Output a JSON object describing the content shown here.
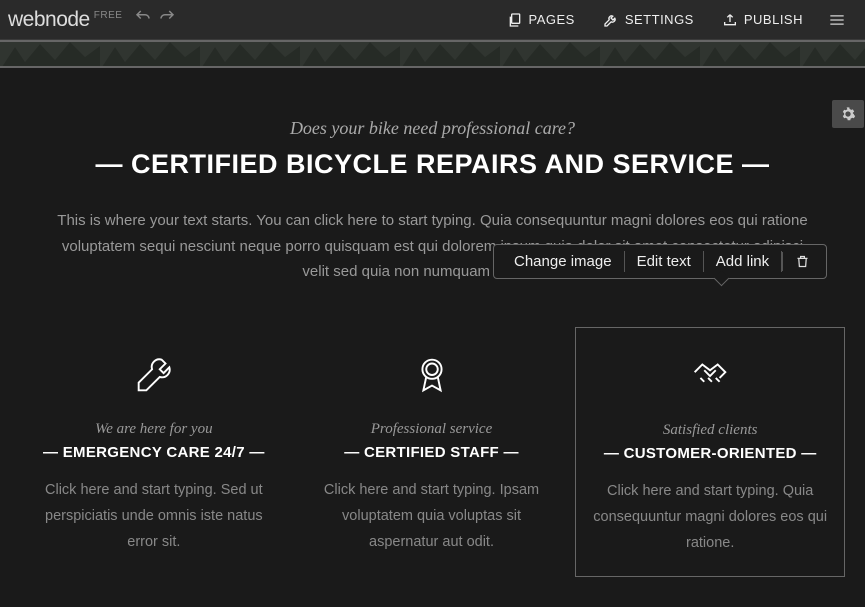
{
  "topbar": {
    "logo": "webnode",
    "plan": "FREE",
    "buttons": {
      "pages": "PAGES",
      "settings": "SETTINGS",
      "publish": "PUBLISH"
    }
  },
  "hero": {
    "subtitle": "Does your bike need professional care?",
    "heading": "— CERTIFIED BICYCLE REPAIRS AND SERVICE —",
    "body": "This is where your text starts. You can click here to start typing. Quia consequuntur magni dolores eos qui ratione voluptatem sequi nesciunt neque porro quisquam est qui dolorem ipsum quia dolor sit amet consectetur adipisci velit sed quia non numquam eius modi."
  },
  "context_toolbar": {
    "change_image": "Change image",
    "edit_text": "Edit text",
    "add_link": "Add link"
  },
  "features": [
    {
      "sub": "We are here for you",
      "head": "— EMERGENCY CARE 24/7 —",
      "body": "Click here and start typing. Sed ut perspiciatis unde omnis iste natus error sit."
    },
    {
      "sub": "Professional service",
      "head": "— CERTIFIED STAFF —",
      "body": "Click here and start typing. Ipsam voluptatem quia voluptas sit aspernatur aut odit."
    },
    {
      "sub": "Satisfied clients",
      "head": "— CUSTOMER-ORIENTED —",
      "body": "Click here and start typing. Quia consequuntur magni dolores eos qui ratione."
    }
  ]
}
